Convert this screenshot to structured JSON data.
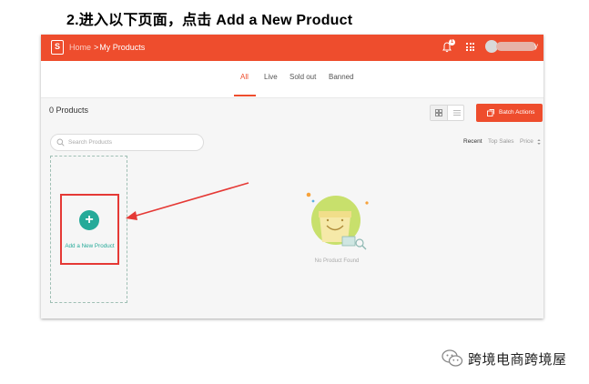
{
  "document": {
    "heading": "2.进入以下页面，点击 Add a New Product"
  },
  "topbar": {
    "logo_letter": "S",
    "breadcrumb_home": "Home",
    "breadcrumb_sep": ">",
    "breadcrumb_current": "My Products",
    "notification_count": "1",
    "username_tail": "y",
    "bg_color": "#ee4d2d"
  },
  "tabs": [
    {
      "label": "All",
      "active": true
    },
    {
      "label": "Live"
    },
    {
      "label": "Sold out"
    },
    {
      "label": "Banned"
    }
  ],
  "toolbar": {
    "product_count": "0 Products",
    "batch_actions_label": "Batch Actions"
  },
  "search": {
    "placeholder": "Search Products"
  },
  "sort": [
    {
      "label": "Recent",
      "active": true
    },
    {
      "label": "Top Sales"
    },
    {
      "label": "Price"
    }
  ],
  "add_product": {
    "plus": "+",
    "label": "Add a New Product",
    "accent": "#26aa99"
  },
  "empty_state": {
    "text": "No Product Found"
  },
  "watermark": {
    "text": "跨境电商跨境屋"
  }
}
